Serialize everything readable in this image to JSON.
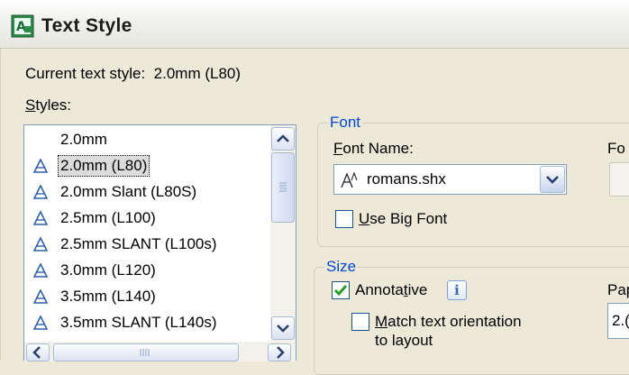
{
  "window": {
    "title": "Text Style",
    "icon": "text-style-app-icon"
  },
  "current_style": {
    "label": "Current text style:",
    "value": "2.0mm (L80)"
  },
  "styles": {
    "label_prefix": "S",
    "label_rest": "tyles:",
    "items": [
      {
        "label": "2.0mm",
        "icon": ""
      },
      {
        "label": "2.0mm (L80)",
        "icon": "annotative-icon"
      },
      {
        "label": "2.0mm Slant (L80S)",
        "icon": "annotative-icon"
      },
      {
        "label": "2.5mm (L100)",
        "icon": "annotative-icon"
      },
      {
        "label": "2.5mm SLANT (L100s)",
        "icon": "annotative-icon"
      },
      {
        "label": "3.0mm (L120)",
        "icon": "annotative-icon"
      },
      {
        "label": "3.5mm (L140)",
        "icon": "annotative-icon"
      },
      {
        "label": "3.5mm SLANT (L140s)",
        "icon": "annotative-icon"
      }
    ],
    "selected_index": 1
  },
  "font_group": {
    "legend": "Font",
    "font_name_prefix": "F",
    "font_name_rest": "ont Name:",
    "font_name_value": "romans.shx",
    "font_style_label_partial": "Fo",
    "use_big_font_prefix": "U",
    "use_big_font_rest": "se Big Font",
    "use_big_font_checked": false
  },
  "size_group": {
    "legend": "Size",
    "annotative_pre": "Annota",
    "annotative_u": "t",
    "annotative_post": "ive",
    "annotative_checked": true,
    "info_glyph": "i",
    "match_prefix": "M",
    "match_line1_rest": "atch text orientation",
    "match_line2": "to layout",
    "match_checked": false,
    "paper_label_partial": "Pap",
    "paper_value_partial": "2.("
  },
  "colors": {
    "legend_blue": "#0046d5",
    "dialog_bg": "#ece9d8",
    "check_green": "#21a121"
  }
}
